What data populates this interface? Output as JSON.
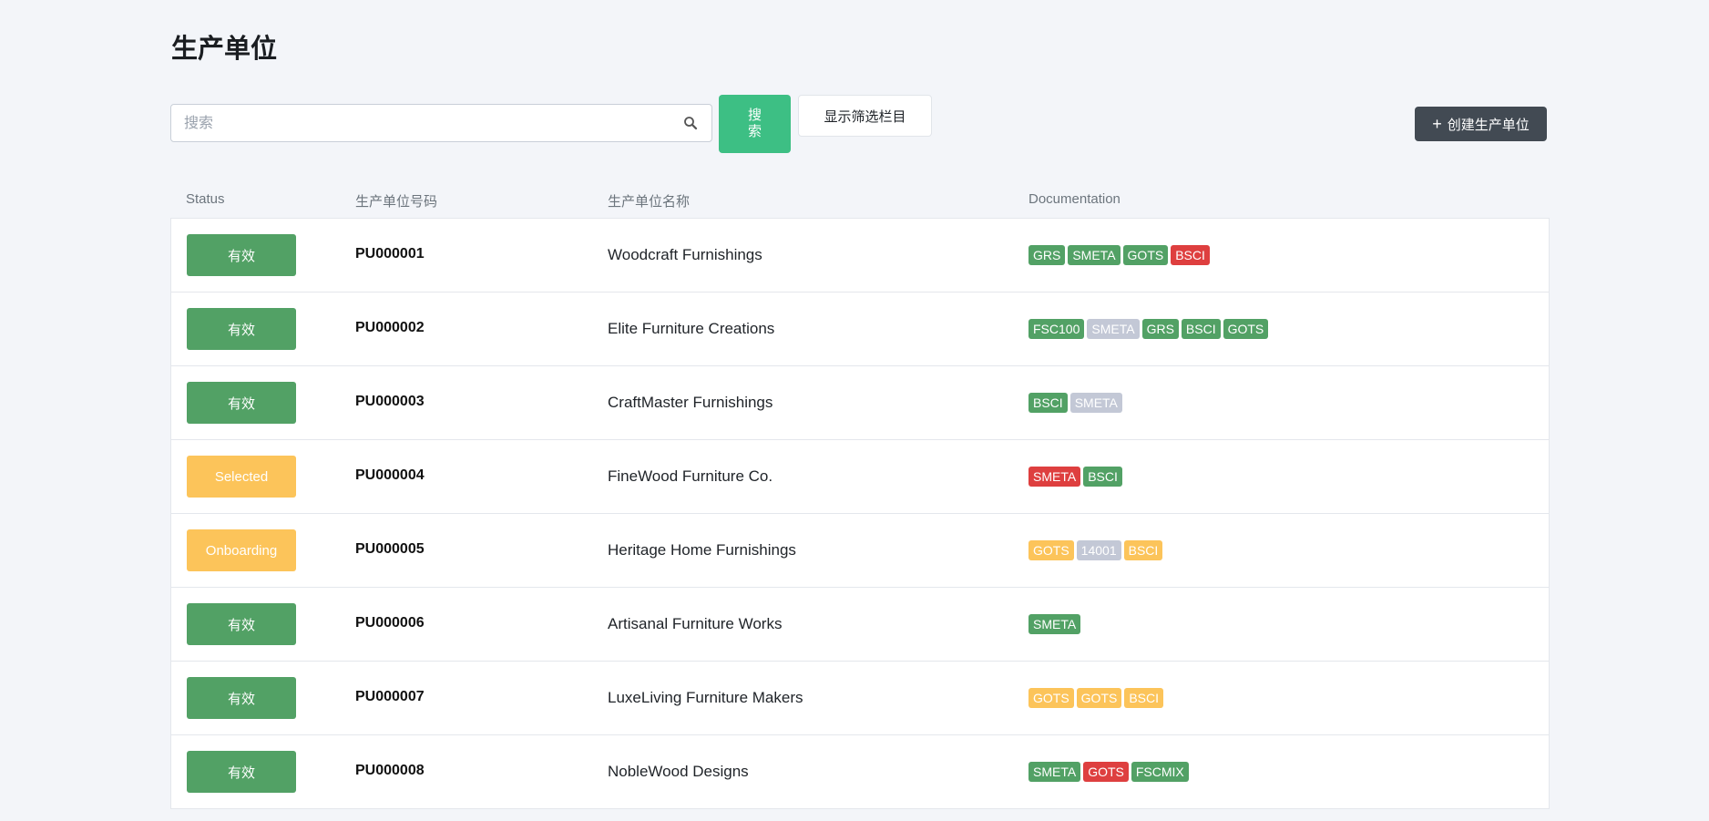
{
  "page": {
    "title": "生产单位"
  },
  "toolbar": {
    "search_placeholder": "搜索",
    "search_button": "搜索",
    "filter_button": "显示筛选栏目",
    "create_button": "创建生产单位"
  },
  "table": {
    "headers": {
      "status": "Status",
      "code": "生产单位号码",
      "name": "生产单位名称",
      "documentation": "Documentation"
    },
    "rows": [
      {
        "status": "有效",
        "status_color": "green",
        "code": "PU000001",
        "name": "Woodcraft Furnishings",
        "docs": [
          {
            "label": "GRS",
            "color": "green"
          },
          {
            "label": "SMETA",
            "color": "green"
          },
          {
            "label": "GOTS",
            "color": "green"
          },
          {
            "label": "BSCI",
            "color": "red"
          }
        ]
      },
      {
        "status": "有效",
        "status_color": "green",
        "code": "PU000002",
        "name": "Elite Furniture Creations",
        "docs": [
          {
            "label": "FSC100",
            "color": "green"
          },
          {
            "label": "SMETA",
            "color": "gray"
          },
          {
            "label": "GRS",
            "color": "green"
          },
          {
            "label": "BSCI",
            "color": "green"
          },
          {
            "label": "GOTS",
            "color": "green"
          }
        ]
      },
      {
        "status": "有效",
        "status_color": "green",
        "code": "PU000003",
        "name": "CraftMaster Furnishings",
        "docs": [
          {
            "label": "BSCI",
            "color": "green"
          },
          {
            "label": "SMETA",
            "color": "gray"
          }
        ]
      },
      {
        "status": "Selected",
        "status_color": "yellow",
        "code": "PU000004",
        "name": "FineWood Furniture Co.",
        "docs": [
          {
            "label": "SMETA",
            "color": "red"
          },
          {
            "label": "BSCI",
            "color": "green"
          }
        ]
      },
      {
        "status": "Onboarding",
        "status_color": "yellow",
        "code": "PU000005",
        "name": "Heritage Home Furnishings",
        "docs": [
          {
            "label": "GOTS",
            "color": "yellow"
          },
          {
            "label": "14001",
            "color": "gray"
          },
          {
            "label": "BSCI",
            "color": "yellow"
          }
        ]
      },
      {
        "status": "有效",
        "status_color": "green",
        "code": "PU000006",
        "name": "Artisanal Furniture Works",
        "docs": [
          {
            "label": "SMETA",
            "color": "green"
          }
        ]
      },
      {
        "status": "有效",
        "status_color": "green",
        "code": "PU000007",
        "name": "LuxeLiving Furniture Makers",
        "docs": [
          {
            "label": "GOTS",
            "color": "yellow"
          },
          {
            "label": "GOTS",
            "color": "yellow"
          },
          {
            "label": "BSCI",
            "color": "yellow"
          }
        ]
      },
      {
        "status": "有效",
        "status_color": "green",
        "code": "PU000008",
        "name": "NobleWood Designs",
        "docs": [
          {
            "label": "SMETA",
            "color": "green"
          },
          {
            "label": "GOTS",
            "color": "red"
          },
          {
            "label": "FSCMIX",
            "color": "green"
          }
        ]
      }
    ]
  },
  "colors": {
    "green": "#52a165",
    "red": "#de3f3f",
    "gray": "#c3c8d6",
    "yellow": "#fcc45a",
    "search_button": "#3dbf84",
    "create_button": "#424a53"
  }
}
